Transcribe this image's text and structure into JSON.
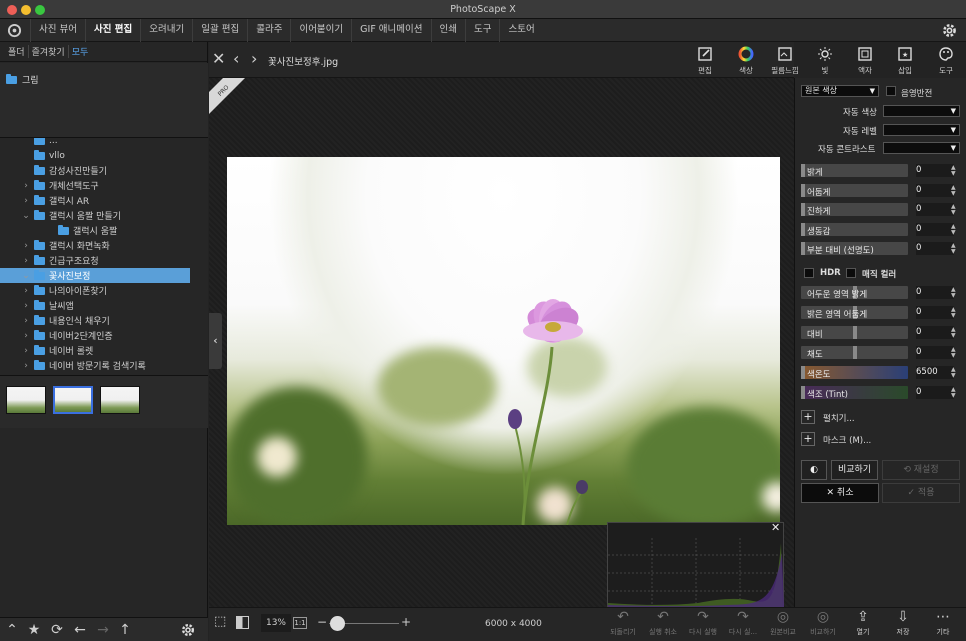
{
  "window": {
    "title": "PhotoScape X"
  },
  "menu": [
    {
      "label": "사진 뷰어",
      "active": false
    },
    {
      "label": "사진 편집",
      "active": true
    },
    {
      "label": "오려내기",
      "active": false
    },
    {
      "label": "일괄 편집",
      "active": false
    },
    {
      "label": "콜라주",
      "active": false
    },
    {
      "label": "이어붙이기",
      "active": false
    },
    {
      "label": "GIF 애니메이션",
      "active": false
    },
    {
      "label": "인쇄",
      "active": false
    },
    {
      "label": "도구",
      "active": false
    },
    {
      "label": "스토어",
      "active": false
    }
  ],
  "left": {
    "tabs": [
      "폴더",
      "즐겨찾기",
      "모두"
    ],
    "favorite": "그림",
    "tree": [
      {
        "label": "...",
        "chev": ""
      },
      {
        "label": "vllo",
        "chev": ""
      },
      {
        "label": "감성사진만들기",
        "chev": ""
      },
      {
        "label": "개체선택도구",
        "chev": ">"
      },
      {
        "label": "갤럭시 AR",
        "chev": ">"
      },
      {
        "label": "갤럭시 움짤 만들기",
        "chev": "v"
      },
      {
        "label": "갤럭시 움짤",
        "chev": "",
        "indent": true
      },
      {
        "label": "갤럭시 화면녹화",
        "chev": ">"
      },
      {
        "label": "긴급구조요청",
        "chev": ">"
      },
      {
        "label": "꽃사진보정",
        "chev": "v",
        "selected": true
      },
      {
        "label": "나의아이폰찾기",
        "chev": ">"
      },
      {
        "label": "날씨앱",
        "chev": ">"
      },
      {
        "label": "내용인식 채우기",
        "chev": ">"
      },
      {
        "label": "네이버2단계인증",
        "chev": ">"
      },
      {
        "label": "네이버 롤렛",
        "chev": ">"
      },
      {
        "label": "네이버 방문기록 검색기록",
        "chev": ">"
      }
    ]
  },
  "editor": {
    "filename": "꽃사진보정후.jpg",
    "pro_badge": "PRO",
    "tools": [
      {
        "label": "편집",
        "icon": "edit-icon",
        "active": false
      },
      {
        "label": "색상",
        "icon": "color-wheel-icon",
        "active": true
      },
      {
        "label": "필름느낌",
        "icon": "film-icon",
        "active": false
      },
      {
        "label": "빛",
        "icon": "sun-icon",
        "active": false
      },
      {
        "label": "액자",
        "icon": "frame-icon",
        "active": false
      },
      {
        "label": "삽입",
        "icon": "insert-icon",
        "active": false
      },
      {
        "label": "도구",
        "icon": "palette-icon",
        "active": false
      }
    ],
    "zoom": "13%",
    "zoom_one": "1:1",
    "image_size": "6000 x 4000",
    "actions": [
      "되돌리기",
      "실행 취소",
      "다시 실행",
      "다시 실...",
      "원본비교",
      "비교하기",
      "열기",
      "저장",
      "기타"
    ]
  },
  "panel": {
    "preset": "원본 색상",
    "invert_label": "음영반전",
    "auto_color": "자동 색상",
    "auto_level": "자동 레벨",
    "auto_contrast": "자동 콘트라스트",
    "sliders1": [
      {
        "label": "밝게",
        "value": "0"
      },
      {
        "label": "어둡게",
        "value": "0"
      },
      {
        "label": "진하게",
        "value": "0"
      },
      {
        "label": "생동감",
        "value": "0"
      },
      {
        "label": "부분 대비 (선명도)",
        "value": "0"
      }
    ],
    "hdr": "HDR",
    "magic": "매직 컬러",
    "sliders2": [
      {
        "label": "어두운 영역 밝게",
        "value": "0"
      },
      {
        "label": "밝은 영역 어둡게",
        "value": "0"
      },
      {
        "label": "대비",
        "value": "0"
      },
      {
        "label": "채도",
        "value": "0"
      },
      {
        "label": "색온도",
        "value": "6500"
      },
      {
        "label": "색조 (Tint)",
        "value": "0"
      }
    ],
    "spread": "펼치기...",
    "mask": "마스크 (M)...",
    "compare": "비교하기",
    "reset": "재설정",
    "cancel": "취소",
    "apply": "적용"
  }
}
